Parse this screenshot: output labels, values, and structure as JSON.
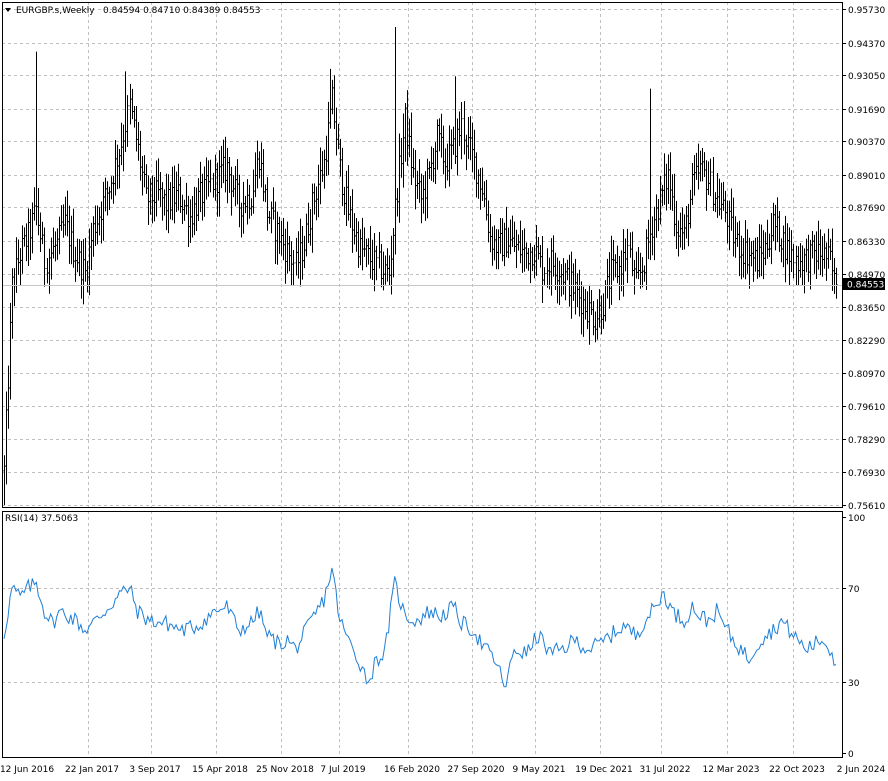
{
  "header": {
    "symbol": "EURGBP.s,Weekly",
    "ohlc": "0.84594 0.84710 0.84389 0.84553"
  },
  "indicator": {
    "label": "RSI(14) 37.5063"
  },
  "colors": {
    "bars": "#000000",
    "rsi": "#1e7fd6",
    "grid": "#c0c0c0",
    "bg": "#ffffff"
  },
  "chart_data": [
    {
      "type": "bar",
      "title": "EURGBP.s,Weekly",
      "last_price": "0.84553",
      "price_axis": [
        "0.95730",
        "0.94370",
        "0.93050",
        "0.91690",
        "0.90370",
        "0.89010",
        "0.87690",
        "0.86330",
        "0.84970",
        "0.83650",
        "0.82290",
        "0.80970",
        "0.79610",
        "0.78290",
        "0.76930",
        "0.75610"
      ],
      "ylim": [
        0.7561,
        0.9573
      ],
      "time_axis": [
        "12 Jun 2016",
        "22 Jan 2017",
        "3 Sep 2017",
        "15 Apr 2018",
        "25 Nov 2018",
        "7 Jul 2019",
        "16 Feb 2020",
        "27 Sep 2020",
        "9 May 2021",
        "19 Dec 2021",
        "31 Jul 2022",
        "12 Mar 2023",
        "22 Oct 2023",
        "2 Jun 2024"
      ],
      "anchors": [
        [
          0,
          0.77
        ],
        [
          4,
          0.845
        ],
        [
          8,
          0.858
        ],
        [
          12,
          0.865
        ],
        [
          16,
          0.876
        ],
        [
          20,
          0.855
        ],
        [
          26,
          0.862
        ],
        [
          30,
          0.87
        ],
        [
          34,
          0.86
        ],
        [
          40,
          0.85
        ],
        [
          44,
          0.868
        ],
        [
          52,
          0.885
        ],
        [
          58,
          0.903
        ],
        [
          62,
          0.918
        ],
        [
          66,
          0.9
        ],
        [
          70,
          0.88
        ],
        [
          76,
          0.882
        ],
        [
          80,
          0.878
        ],
        [
          86,
          0.882
        ],
        [
          92,
          0.873
        ],
        [
          96,
          0.88
        ],
        [
          104,
          0.888
        ],
        [
          110,
          0.893
        ],
        [
          116,
          0.878
        ],
        [
          122,
          0.882
        ],
        [
          126,
          0.898
        ],
        [
          130,
          0.875
        ],
        [
          138,
          0.862
        ],
        [
          144,
          0.853
        ],
        [
          148,
          0.862
        ],
        [
          152,
          0.878
        ],
        [
          158,
          0.895
        ],
        [
          162,
          0.92
        ],
        [
          166,
          0.892
        ],
        [
          170,
          0.875
        ],
        [
          176,
          0.86
        ],
        [
          182,
          0.855
        ],
        [
          186,
          0.852
        ],
        [
          190,
          0.85
        ],
        [
          194,
          0.885
        ],
        [
          198,
          0.912
        ],
        [
          202,
          0.89
        ],
        [
          206,
          0.88
        ],
        [
          210,
          0.89
        ],
        [
          214,
          0.905
        ],
        [
          218,
          0.895
        ],
        [
          222,
          0.9
        ],
        [
          226,
          0.91
        ],
        [
          230,
          0.9
        ],
        [
          236,
          0.885
        ],
        [
          240,
          0.865
        ],
        [
          244,
          0.86
        ],
        [
          248,
          0.864
        ],
        [
          254,
          0.86
        ],
        [
          258,
          0.858
        ],
        [
          262,
          0.86
        ],
        [
          266,
          0.852
        ],
        [
          270,
          0.855
        ],
        [
          276,
          0.85
        ],
        [
          282,
          0.843
        ],
        [
          288,
          0.836
        ],
        [
          292,
          0.832
        ],
        [
          296,
          0.838
        ],
        [
          300,
          0.85
        ],
        [
          304,
          0.852
        ],
        [
          308,
          0.86
        ],
        [
          312,
          0.845
        ],
        [
          316,
          0.855
        ],
        [
          320,
          0.87
        ],
        [
          324,
          0.88
        ],
        [
          328,
          0.89
        ],
        [
          332,
          0.87
        ],
        [
          336,
          0.865
        ],
        [
          340,
          0.885
        ],
        [
          344,
          0.892
        ],
        [
          348,
          0.888
        ],
        [
          352,
          0.88
        ],
        [
          356,
          0.875
        ],
        [
          360,
          0.865
        ],
        [
          364,
          0.86
        ],
        [
          368,
          0.858
        ],
        [
          372,
          0.855
        ],
        [
          376,
          0.86
        ],
        [
          380,
          0.87
        ],
        [
          384,
          0.865
        ],
        [
          388,
          0.858
        ],
        [
          392,
          0.855
        ],
        [
          396,
          0.856
        ],
        [
          400,
          0.858
        ],
        [
          404,
          0.858
        ],
        [
          408,
          0.855
        ],
        [
          410,
          0.846
        ]
      ],
      "spikes": [
        [
          16,
          0.94
        ],
        [
          60,
          0.932
        ],
        [
          161,
          0.933
        ],
        [
          193,
          0.95
        ],
        [
          223,
          0.93
        ],
        [
          319,
          0.925
        ],
        [
          100,
          0.88
        ],
        [
          0,
          0.7561
        ]
      ],
      "rsi": {
        "name": "RSI(14)",
        "last": "37.5063",
        "axis": [
          "100",
          "70",
          "30",
          "0"
        ],
        "ylim": [
          0,
          100
        ],
        "anchors": [
          [
            0,
            50
          ],
          [
            4,
            70
          ],
          [
            8,
            66
          ],
          [
            12,
            70
          ],
          [
            16,
            72
          ],
          [
            20,
            60
          ],
          [
            24,
            55
          ],
          [
            28,
            60
          ],
          [
            32,
            58
          ],
          [
            36,
            56
          ],
          [
            40,
            52
          ],
          [
            44,
            55
          ],
          [
            52,
            62
          ],
          [
            58,
            68
          ],
          [
            62,
            70
          ],
          [
            66,
            60
          ],
          [
            72,
            56
          ],
          [
            80,
            55
          ],
          [
            88,
            52
          ],
          [
            96,
            54
          ],
          [
            104,
            60
          ],
          [
            110,
            62
          ],
          [
            116,
            52
          ],
          [
            122,
            55
          ],
          [
            126,
            60
          ],
          [
            130,
            50
          ],
          [
            136,
            46
          ],
          [
            140,
            48
          ],
          [
            144,
            44
          ],
          [
            148,
            50
          ],
          [
            152,
            56
          ],
          [
            158,
            65
          ],
          [
            162,
            78
          ],
          [
            166,
            56
          ],
          [
            170,
            48
          ],
          [
            176,
            38
          ],
          [
            180,
            30
          ],
          [
            184,
            40
          ],
          [
            188,
            42
          ],
          [
            193,
            72
          ],
          [
            198,
            58
          ],
          [
            204,
            56
          ],
          [
            210,
            60
          ],
          [
            216,
            58
          ],
          [
            222,
            62
          ],
          [
            226,
            55
          ],
          [
            232,
            52
          ],
          [
            236,
            46
          ],
          [
            242,
            40
          ],
          [
            248,
            28
          ],
          [
            252,
            44
          ],
          [
            258,
            42
          ],
          [
            264,
            50
          ],
          [
            270,
            42
          ],
          [
            276,
            44
          ],
          [
            282,
            48
          ],
          [
            288,
            44
          ],
          [
            294,
            46
          ],
          [
            300,
            50
          ],
          [
            306,
            54
          ],
          [
            312,
            50
          ],
          [
            318,
            58
          ],
          [
            322,
            62
          ],
          [
            326,
            68
          ],
          [
            330,
            60
          ],
          [
            336,
            56
          ],
          [
            340,
            62
          ],
          [
            344,
            58
          ],
          [
            348,
            56
          ],
          [
            352,
            60
          ],
          [
            356,
            54
          ],
          [
            360,
            48
          ],
          [
            364,
            44
          ],
          [
            368,
            40
          ],
          [
            372,
            46
          ],
          [
            376,
            50
          ],
          [
            380,
            52
          ],
          [
            384,
            56
          ],
          [
            388,
            52
          ],
          [
            392,
            48
          ],
          [
            396,
            44
          ],
          [
            400,
            46
          ],
          [
            404,
            48
          ],
          [
            408,
            44
          ],
          [
            411,
            37.5
          ]
        ]
      }
    }
  ]
}
